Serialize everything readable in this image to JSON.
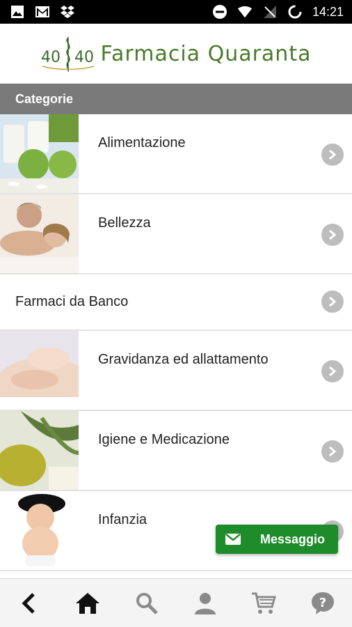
{
  "status_bar": {
    "time": "14:21",
    "left_icons": [
      "image-icon",
      "gmail-icon",
      "dropbox-icon"
    ],
    "right_icons": [
      "dnd-icon",
      "wifi-icon",
      "signal-icon",
      "battery-icon"
    ]
  },
  "header": {
    "logo_numbers": "40 40",
    "title": "Farmacia Quaranta",
    "brand_color": "#4a7a2a"
  },
  "section": {
    "title": "Categorie"
  },
  "categories": [
    {
      "label": "Alimentazione",
      "has_image": true,
      "image": "alimentazione"
    },
    {
      "label": "Bellezza",
      "has_image": true,
      "image": "bellezza"
    },
    {
      "label": "Farmaci da Banco",
      "has_image": false
    },
    {
      "label": "Gravidanza ed allattamento",
      "has_image": true,
      "image": "gravidanza"
    },
    {
      "label": "Igiene e Medicazione",
      "has_image": true,
      "image": "igiene"
    },
    {
      "label": "Infanzia",
      "has_image": true,
      "image": "infanzia"
    }
  ],
  "message_button": {
    "label": "Messaggio",
    "color": "#1f8c2b"
  },
  "bottom_nav": [
    {
      "name": "back",
      "icon": "back-arrow-icon"
    },
    {
      "name": "home",
      "icon": "home-icon"
    },
    {
      "name": "search",
      "icon": "search-icon"
    },
    {
      "name": "account",
      "icon": "user-icon"
    },
    {
      "name": "cart",
      "icon": "cart-icon"
    },
    {
      "name": "help",
      "icon": "help-icon"
    }
  ]
}
